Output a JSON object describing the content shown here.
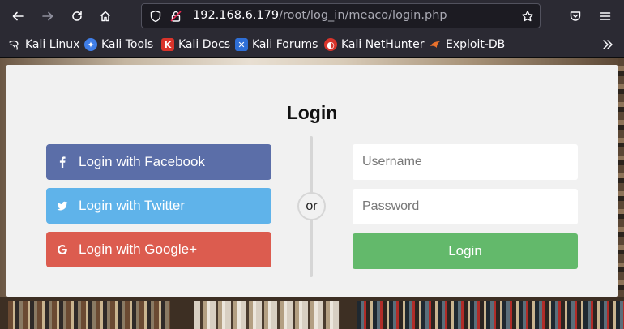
{
  "browser": {
    "url_host": "192.168.6.179",
    "url_path": "/root/log_in/meaco/login.php"
  },
  "bookmarks": [
    {
      "label": "Kali Linux",
      "icon": "kali-dragon-icon",
      "color": "#fbfbfe"
    },
    {
      "label": "Kali Tools",
      "icon": "kali-tools-icon",
      "color": "#3f7ee8"
    },
    {
      "label": "Kali Docs",
      "icon": "kali-docs-icon",
      "color": "#d9342b"
    },
    {
      "label": "Kali Forums",
      "icon": "kali-forums-icon",
      "color": "#2f6fd6"
    },
    {
      "label": "Kali NetHunter",
      "icon": "kali-nethunter-icon",
      "color": "#d9342b"
    },
    {
      "label": "Exploit-DB",
      "icon": "exploit-db-icon",
      "color": "#e8712c"
    }
  ],
  "login": {
    "title": "Login",
    "facebook_label": "Login with Facebook",
    "twitter_label": "Login with Twitter",
    "google_label": "Login with Google+",
    "or_label": "or",
    "username_placeholder": "Username",
    "password_placeholder": "Password",
    "submit_label": "Login"
  },
  "colors": {
    "facebook": "#5b6ea8",
    "twitter": "#5fb3ea",
    "google": "#dc5c4f",
    "submit": "#63b96b"
  }
}
